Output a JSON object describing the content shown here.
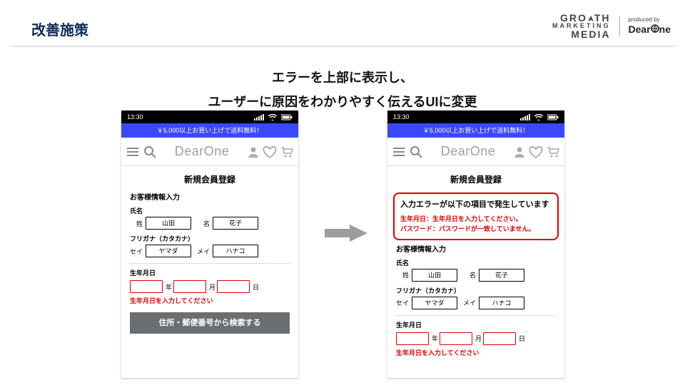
{
  "header": {
    "slide_title": "改善施策",
    "logo_gmm": {
      "l1a": "GRO",
      "l1b": "TH",
      "l2": "MARKETING",
      "l3": "MEDIA"
    },
    "logo_do": {
      "small": "produced by",
      "big_a": "Dear",
      "big_b": "ne"
    }
  },
  "headline": {
    "line1": "エラーを上部に表示し、",
    "line2": "ユーザーに原因をわかりやすく伝えるUIに変更"
  },
  "phone": {
    "time": "13:30",
    "promo": "￥5,000以上お買い上げで送料無料！",
    "brand": "DearOne",
    "reg_title": "新規会員登録",
    "sub_customer": "お客様情報入力",
    "name_label": "氏名",
    "name_sei": "姓",
    "name_mei": "名",
    "name_sei_v": "山田",
    "name_mei_v": "花子",
    "furigana_label": "フリガナ（カタカナ）",
    "furi_sei": "セイ",
    "furi_mei": "メイ",
    "furi_sei_v": "ヤマダ",
    "furi_mei_v": "ハナコ",
    "dob_label": "生年月日",
    "unit_y": "年",
    "unit_m": "月",
    "unit_d": "日",
    "dob_err": "生年月日を入力してください",
    "search_btn": "住所・郵便番号から検索する"
  },
  "errorbox": {
    "head": "入力エラーが以下の項目で発生しています",
    "l1": "生年月日：生年月日を入力してください。",
    "l2": "パスワード：パスワードが一致していません。"
  }
}
